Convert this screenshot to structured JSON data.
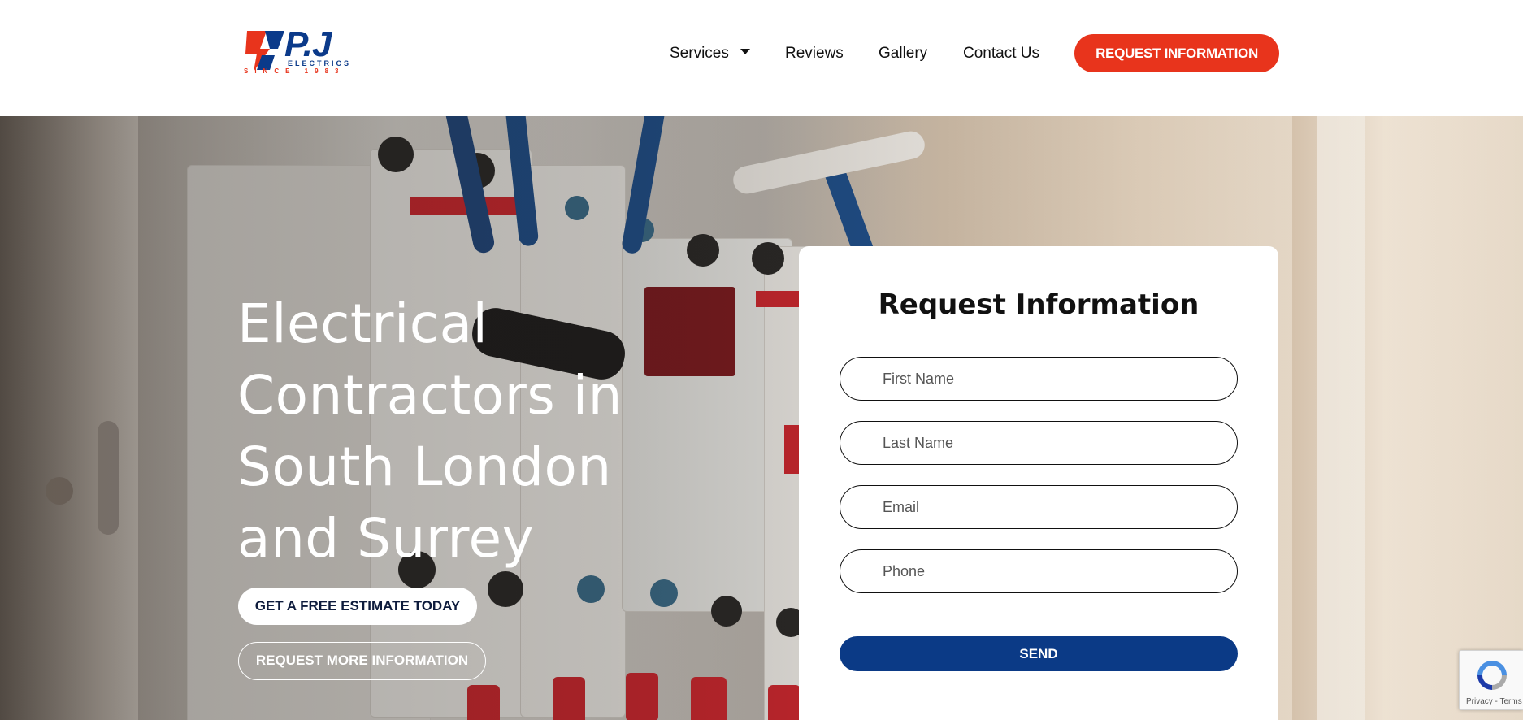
{
  "brand": {
    "logo_name": "P.J",
    "logo_subtitle": "ELECTRICS",
    "logo_since": "SINCE 1983",
    "colors": {
      "red": "#e8341c",
      "blue": "#0b3a8a",
      "send": "#0b3a86"
    }
  },
  "nav": {
    "items": [
      {
        "label": "Services",
        "has_dropdown": true
      },
      {
        "label": "Reviews"
      },
      {
        "label": "Gallery"
      },
      {
        "label": "Contact Us"
      }
    ],
    "cta_label": "REQUEST INFORMATION"
  },
  "hero": {
    "title": "Electrical Contractors in South London and Surrey",
    "primary_button": "GET A FREE ESTIMATE TODAY",
    "secondary_button": "REQUEST MORE INFORMATION"
  },
  "form": {
    "title": "Request Information",
    "fields": [
      {
        "placeholder": "First Name"
      },
      {
        "placeholder": "Last Name"
      },
      {
        "placeholder": "Email"
      },
      {
        "placeholder": "Phone"
      }
    ],
    "submit_label": "SEND"
  },
  "recaptcha": {
    "footer_text": "Privacy - Terms",
    "icon": "recaptcha-icon"
  }
}
